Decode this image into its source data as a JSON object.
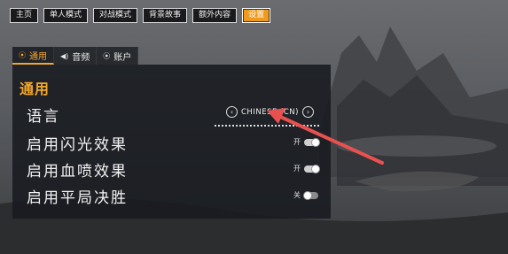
{
  "nav": {
    "items": [
      {
        "label": "主页",
        "active": false
      },
      {
        "label": "单人模式",
        "active": false
      },
      {
        "label": "对战模式",
        "active": false
      },
      {
        "label": "背景故事",
        "active": false
      },
      {
        "label": "额外内容",
        "active": false
      },
      {
        "label": "设置",
        "active": true
      }
    ]
  },
  "tabs": [
    {
      "label": "通用",
      "icon": "gear-icon",
      "active": true
    },
    {
      "label": "音频",
      "icon": "speaker-icon",
      "active": false
    },
    {
      "label": "账户",
      "icon": "account-icon",
      "active": false
    }
  ],
  "settings": {
    "section_title": "通用",
    "language": {
      "label": "语言",
      "value": "CHINESE (CN)"
    },
    "flash": {
      "label": "启用闪光效果",
      "state_label": "开",
      "on": true
    },
    "blood": {
      "label": "启用血喷效果",
      "state_label": "开",
      "on": true
    },
    "draw": {
      "label": "启用平局决胜",
      "state_label": "关",
      "on": false
    }
  },
  "colors": {
    "accent": "#f3a72c",
    "annotation_arrow": "#e8514f",
    "panel": "#181a20"
  }
}
